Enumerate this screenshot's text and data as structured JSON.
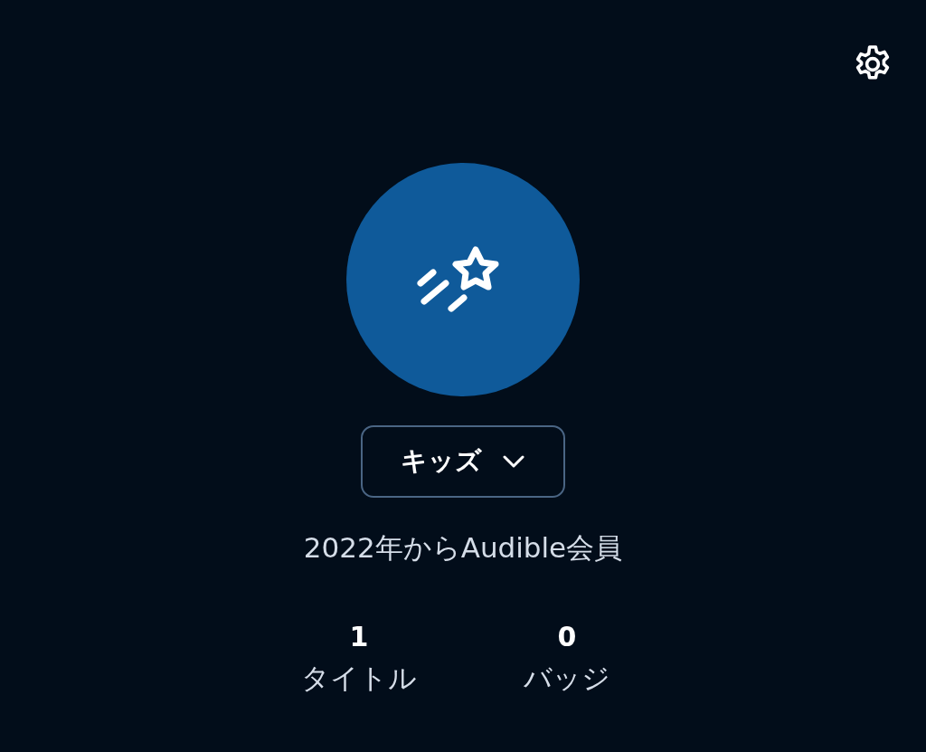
{
  "profile_switcher": {
    "label": "キッズ"
  },
  "member_since": "2022年からAudible会員",
  "stats": [
    {
      "value": "1",
      "label": "タイトル"
    },
    {
      "value": "0",
      "label": "バッジ"
    }
  ]
}
